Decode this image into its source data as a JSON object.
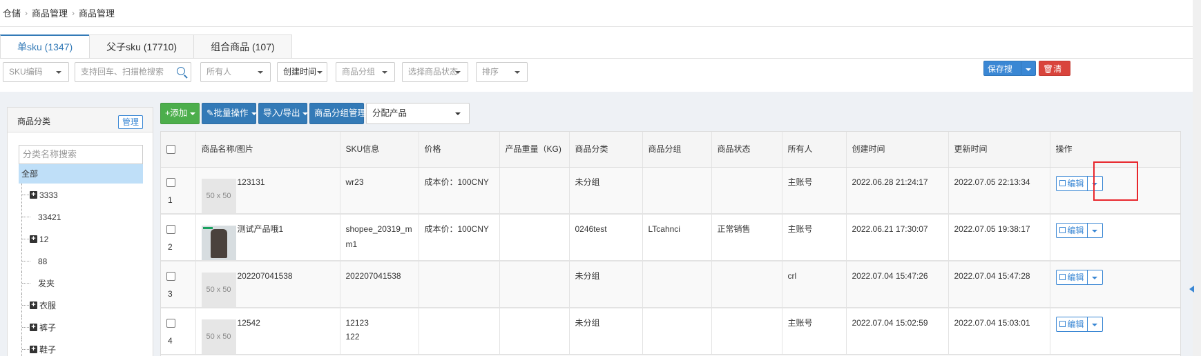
{
  "breadcrumb": [
    "仓储",
    "商品管理",
    "商品管理"
  ],
  "tabs": [
    {
      "label": "单sku (1347)",
      "active": true
    },
    {
      "label": "父子sku (17710)",
      "active": false
    },
    {
      "label": "组合商品 (107)",
      "active": false
    }
  ],
  "filters": {
    "sku_code": "SKU编码",
    "search_placeholder": "支持回车、扫描枪搜索",
    "owner": "所有人",
    "created_time": "创建时间",
    "product_group": "商品分组",
    "product_status": "选择商品状态",
    "sort": "排序",
    "save_search": "保存搜索",
    "clear": "清空"
  },
  "category_panel": {
    "title": "商品分类",
    "manage": "管理",
    "search_placeholder": "分类名称搜索",
    "all": "全部",
    "items": [
      {
        "label": "3333",
        "expandable": true
      },
      {
        "label": "33421",
        "expandable": false
      },
      {
        "label": "12",
        "expandable": true
      },
      {
        "label": "88",
        "expandable": false
      },
      {
        "label": "发夹",
        "expandable": false
      },
      {
        "label": "衣服",
        "expandable": true
      },
      {
        "label": "裤子",
        "expandable": true
      },
      {
        "label": "鞋子",
        "expandable": true
      }
    ]
  },
  "toolbar": {
    "add": "添加",
    "batch": "批量操作",
    "import_export": "导入/导出",
    "group_manage": "商品分组管理",
    "assign": "分配产品"
  },
  "table": {
    "headers": [
      "",
      "商品名称/图片",
      "SKU信息",
      "价格",
      "产品重量（KG)",
      "商品分类",
      "商品分组",
      "商品状态",
      "所有人",
      "创建时间",
      "更新时间",
      "操作"
    ],
    "edit_label": "编辑",
    "rows": [
      {
        "num": "1",
        "name": "123131",
        "image": "50 x 50",
        "sku": "wr23",
        "sku2": "",
        "price": "成本价：100CNY",
        "weight": "",
        "category": "未分组",
        "group": "",
        "status": "",
        "owner": "主账号",
        "created": "2022.06.28 21:24:17",
        "updated": "2022.07.05 22:13:34"
      },
      {
        "num": "2",
        "name": "测试产品哦1",
        "image": "",
        "sku": "shopee_20319_mm1",
        "sku2": "",
        "price": "成本价：100CNY",
        "weight": "",
        "category": "0246test",
        "group": "LTcahnci",
        "status": "正常销售",
        "owner": "主账号",
        "created": "2022.06.21 17:30:07",
        "updated": "2022.07.05 19:38:17"
      },
      {
        "num": "3",
        "name": "202207041538",
        "image": "50 x 50",
        "sku": "202207041538",
        "sku2": "",
        "price": "",
        "weight": "",
        "category": "未分组",
        "group": "",
        "status": "",
        "owner": "crl",
        "created": "2022.07.04 15:47:26",
        "updated": "2022.07.04 15:47:28"
      },
      {
        "num": "4",
        "name": "12542",
        "image": "50 x 50",
        "sku": "12123",
        "sku2": "122",
        "price": "",
        "weight": "",
        "category": "未分组",
        "group": "",
        "status": "",
        "owner": "主账号",
        "created": "2022.07.04 15:02:59",
        "updated": "2022.07.04 15:03:01"
      }
    ]
  },
  "colors": {
    "primary": "#337ab7",
    "success": "#4cae4c",
    "danger": "#d9443c",
    "highlight": "#e8262c"
  }
}
